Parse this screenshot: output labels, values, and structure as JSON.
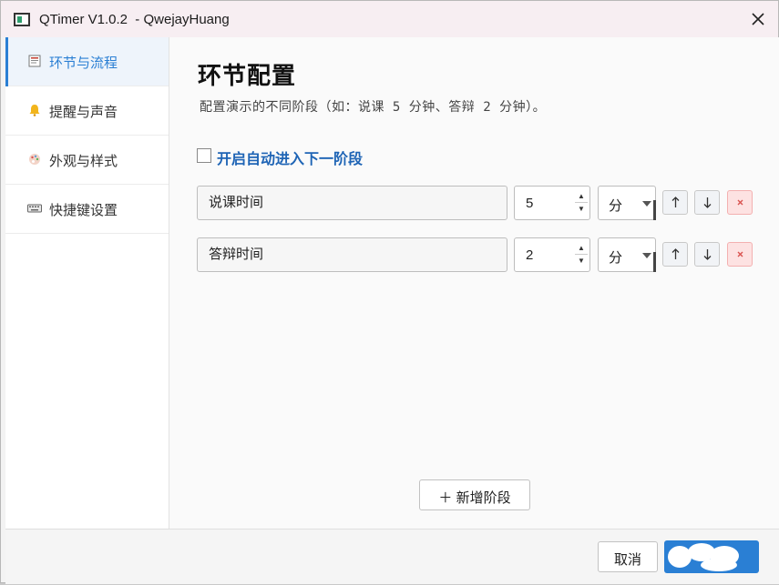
{
  "window": {
    "title": "QTimer V1.0.2  - QwejayHuang"
  },
  "sidebar": {
    "items": [
      {
        "label": "环节与流程",
        "icon": "note-icon",
        "active": true
      },
      {
        "label": "提醒与声音",
        "icon": "bell-icon",
        "active": false
      },
      {
        "label": "外观与样式",
        "icon": "palette-icon",
        "active": false
      },
      {
        "label": "快捷键设置",
        "icon": "keyboard-icon",
        "active": false
      }
    ]
  },
  "main": {
    "title": "环节配置",
    "description": "配置演示的不同阶段（如：说课 5 分钟、答辩 2 分钟）。",
    "auto_advance": {
      "label": "开启自动进入下一阶段",
      "checked": false
    },
    "stages": [
      {
        "name": "说课时间",
        "duration": "5",
        "unit": "分"
      },
      {
        "name": "答辩时间",
        "duration": "2",
        "unit": "分"
      }
    ],
    "add_stage_label": "＋ 新增阶段"
  },
  "footer": {
    "cancel_label": "取消"
  },
  "colors": {
    "accent": "#2a7fd4",
    "checkbox_label": "#1e64b5",
    "delete_bg": "#fde2e2"
  }
}
